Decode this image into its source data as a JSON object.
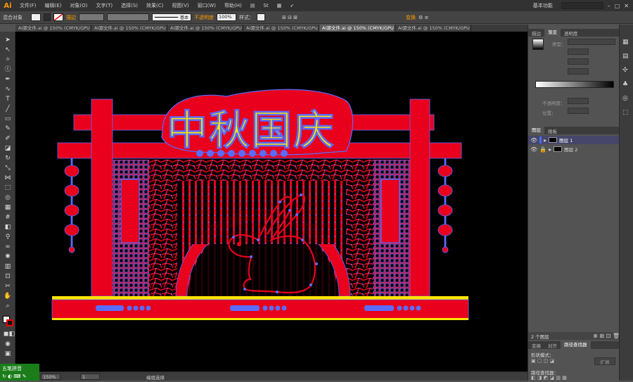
{
  "app": {
    "logo": "Ai"
  },
  "menu": [
    "文件(F)",
    "编辑(E)",
    "对象(O)",
    "文字(T)",
    "选择(S)",
    "效果(C)",
    "视图(V)",
    "窗口(W)",
    "帮助(H)"
  ],
  "workspace": "基本功能",
  "control": {
    "object_label": "混合对象",
    "stroke_label": "描边",
    "stroke_style": "基本",
    "opacity_label": "不透明度",
    "opacity_value": "100%",
    "style_label": "样式：",
    "transform_label": "变换"
  },
  "tabs": [
    "AI源文件.ai @ 150% (CMYK/GPU 预览)",
    "AI源文件.ai @ 150% (CMYK/GPU 预览)",
    "AI源文件.ai @ 150% (CMYK/GPU 预览)",
    "AI源文件.ai @ 150% (CMYK/GPU 预览)",
    "AI源文件.ai @ 150% (CMYK/GPU 预览)",
    "AI源文件.ai @ 150% (CMYK/GPU 预览)"
  ],
  "artwork": {
    "headline": "中秋国庆"
  },
  "gradient_panel": {
    "tabs": [
      "描边",
      "渐变",
      "透明度"
    ],
    "type_label": "类型：",
    "opacity_label": "不透明度：",
    "position_label": "位置："
  },
  "layers_panel": {
    "tabs": [
      "图层",
      "画板"
    ],
    "layers": [
      {
        "name": "图层 1",
        "color": "#4f6bff"
      },
      {
        "name": "图层 2",
        "color": "#ff3a3a"
      }
    ],
    "count": "2 个图层"
  },
  "pathfinder_panel": {
    "tabs": [
      "变换",
      "对齐",
      "路径查找器"
    ],
    "shape_mode_label": "形状模式：",
    "expand_label": "扩展",
    "pathfinder_label": "路径查找器："
  },
  "status": {
    "zoom": "150%",
    "page": "1",
    "tool": "编组选择"
  },
  "ime": {
    "label": "五笔拼音"
  },
  "colors": {
    "art_red": "#e8001c",
    "anchor_blue": "#5a6cff",
    "title_yellow": "#ffe400",
    "ui_orange": "#ff9a00"
  }
}
